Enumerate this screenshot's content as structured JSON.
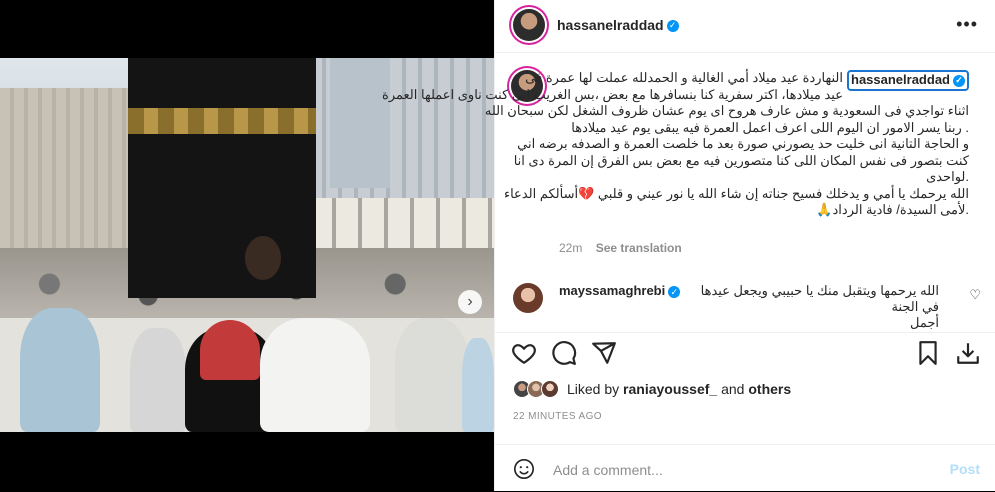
{
  "post": {
    "username": "hassanelraddad",
    "more_icon": "more-horizontal-icon",
    "caption_lines": [
      "النهاردة عيد ميلاد أمي الغالية و الحمدلله عملت لها عمرة فى",
      "عيد ميلادها، اكتر سفرية كنا بنسافرها مع بعض ،بس الغريب انى كنت ناوى اعملها العمرة",
      "اثناء تواجدي فى السعودية و مش عارف هروح اى يوم عشان ظروف الشغل لكن سبحان الله",
      ". ربنا يسر الامور ان اليوم اللى اعرف اعمل العمرة فيه يبقى يوم عيد ميلادها",
      "و الحاجة التانية انى خليت حد يصورني صورة بعد ما خلصت العمرة و الصدفه برضه اني",
      "كنت بتصور فى نفس المكان اللى كنا متصورين فيه مع بعض بس الفرق إن المرة دى انا",
      ".لواحدى",
      "الله يرحمك يا أمي و يدخلك فسيح جناته إن شاء الله يا نور عيني و قلبي 💔أسألكم الدعاء",
      ".لأمى السيدة/ فادية الرداد🙏"
    ],
    "caption_time": "22m",
    "see_translation": "See translation",
    "comment": {
      "username": "mayssamaghrebi",
      "text_line1": "الله يرحمها ويتقبل منك يا حبيبي ويجعل عيدها في الجنة",
      "text_line2": "أجمل"
    },
    "likes": {
      "prefix": "Liked by",
      "user": "raniayoussef_",
      "and": "and",
      "others": "others"
    },
    "timestamp": "22 MINUTES AGO",
    "add_comment_placeholder": "Add a comment...",
    "post_button": "Post",
    "carousel": {
      "slide_count": 2,
      "active_slide": 1
    }
  },
  "colors": {
    "accent_blue": "#0095f6",
    "post_disabled": "#b2dffc",
    "story_ring": "#d6249f"
  }
}
